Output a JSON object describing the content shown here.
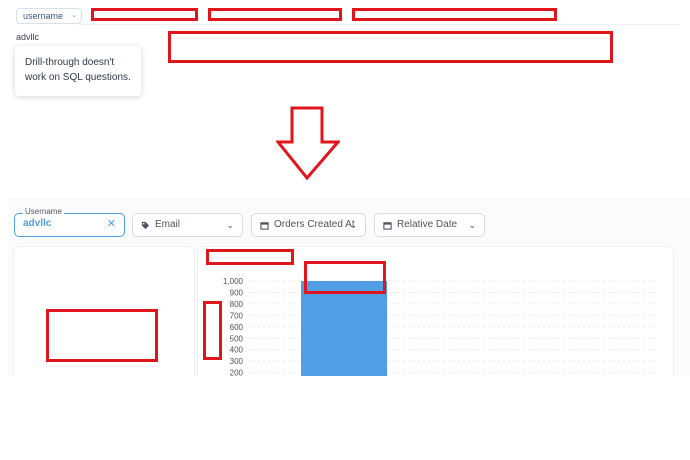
{
  "top_panel": {
    "filter_pill_label": "username",
    "filter_pill_chevron": "chevron-down-icon",
    "filter_value": "advllc",
    "tooltip_text": "Drill-through doesn't work on SQL questions."
  },
  "arrow": {
    "icon": "down-arrow-icon",
    "color": "#e0161d"
  },
  "bottom_panel": {
    "username_filter": {
      "legend": "Username",
      "value": "advllc",
      "clear_icon": "close-icon",
      "clear_glyph": "✕"
    },
    "filters": [
      {
        "label": "Email",
        "icon": "tag-icon"
      },
      {
        "label": "Orders Created At",
        "icon": "calendar-icon"
      },
      {
        "label": "Relative Date",
        "icon": "calendar-icon"
      }
    ]
  },
  "redaction_color": "#e0161d",
  "accent_color": "#509ee3",
  "chart_data": {
    "type": "bar",
    "categories": [
      ""
    ],
    "values": [
      1000
    ],
    "y_ticks": [
      "1,000",
      "900",
      "800",
      "700",
      "600",
      "500",
      "400",
      "300",
      "200"
    ],
    "ylim": [
      0,
      1050
    ],
    "grid": true,
    "bar_color": "#509ee3"
  }
}
